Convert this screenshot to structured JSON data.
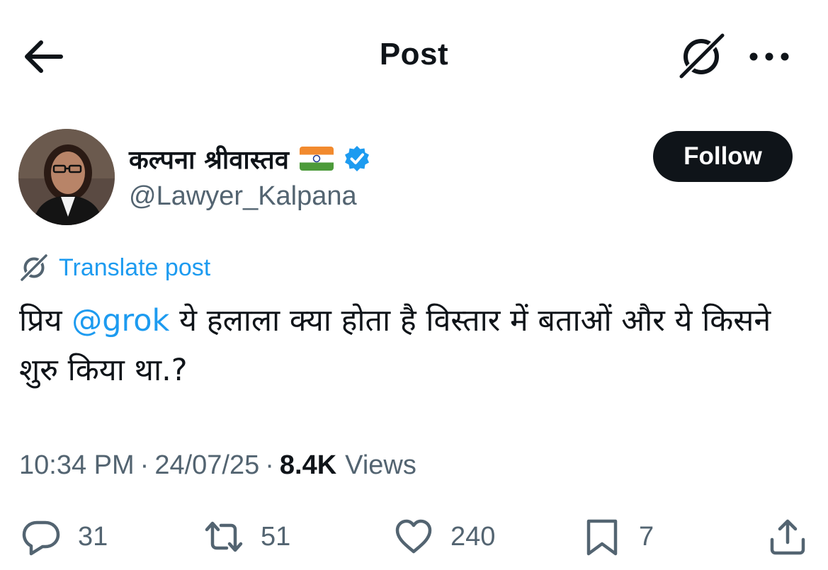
{
  "header": {
    "title": "Post",
    "back_icon": "arrow-left-icon",
    "grok_icon": "grok-icon",
    "more_icon": "more-dots-icon"
  },
  "author": {
    "display_name": "कल्पना श्रीवास्तव",
    "handle": "@Lawyer_Kalpana",
    "flag_icon": "india-flag-icon",
    "verified_icon": "verified-badge-icon",
    "verified_color": "#1d9bf0"
  },
  "follow": {
    "label": "Follow"
  },
  "translate": {
    "label": "Translate post"
  },
  "post": {
    "prefix": "प्रिय ",
    "mention": "@grok",
    "body": " ये हलाला क्या होता है विस्तार में बताओं और ये किसने शुरु किया था.?"
  },
  "meta": {
    "time": "10:34 PM",
    "separator": "·",
    "date": "24/07/25",
    "views_count": "8.4K",
    "views_label": "Views"
  },
  "actions": {
    "replies": "31",
    "reposts": "51",
    "likes": "240",
    "bookmarks": "7"
  },
  "colors": {
    "accent": "#1d9bf0",
    "text": "#0f1419",
    "secondary": "#536471",
    "follow_bg": "#0f1419"
  }
}
